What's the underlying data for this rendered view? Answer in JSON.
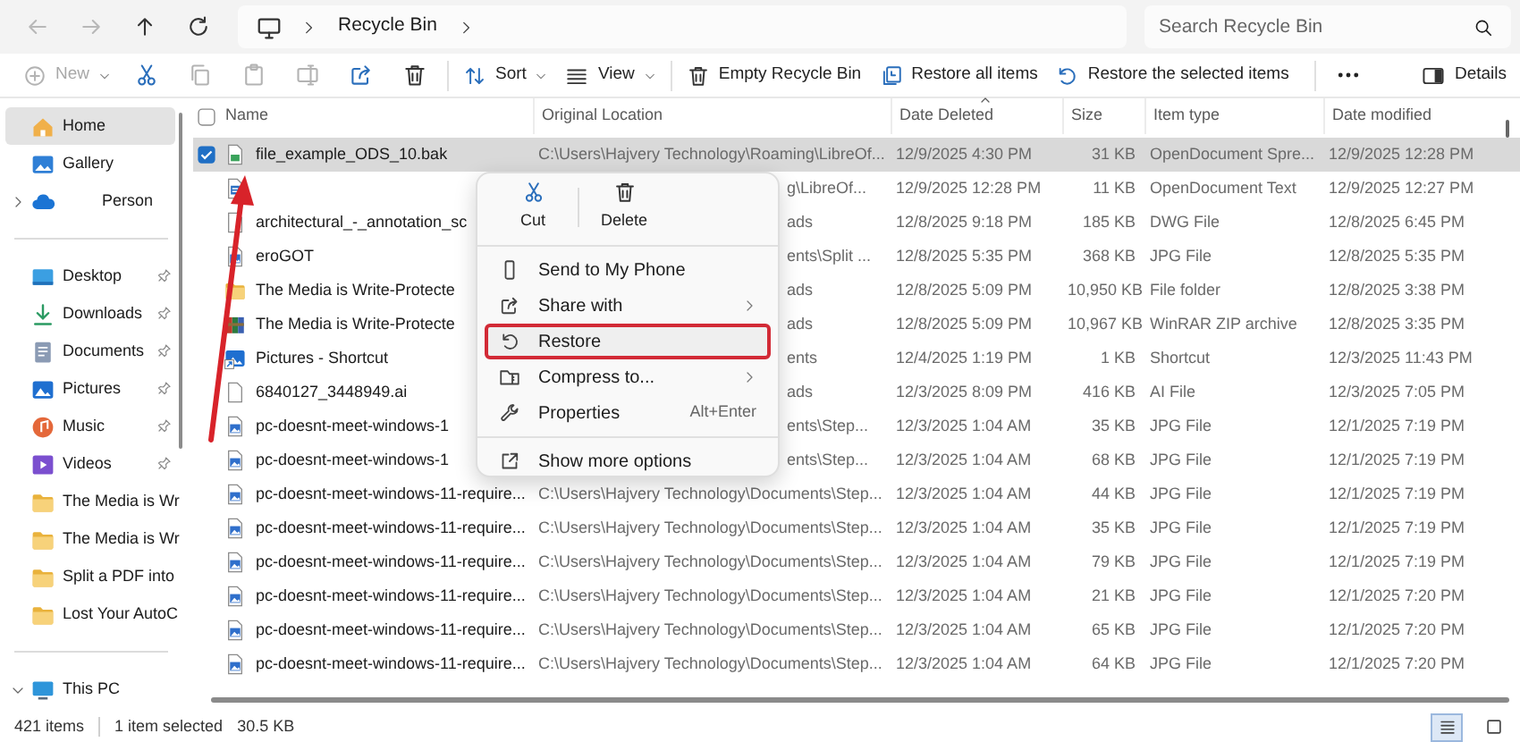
{
  "nav": [
    {
      "disabled": true
    },
    {
      "disabled": true
    },
    {
      "disabled": false
    },
    {
      "disabled": false
    }
  ],
  "address": {
    "crumbs": [
      "Recycle Bin"
    ]
  },
  "search": {
    "placeholder": "Search Recycle Bin"
  },
  "toolbar": {
    "groups": [
      [
        {
          "label": "New",
          "disabled": true,
          "dropdown": true
        },
        {
          "disabled": false,
          "dropdown": false
        },
        {
          "disabled": true,
          "dropdown": false
        },
        {
          "disabled": true,
          "dropdown": false
        },
        {
          "disabled": true,
          "dropdown": false
        },
        {
          "disabled": false,
          "dropdown": false
        },
        {
          "disabled": false,
          "dropdown": false
        }
      ],
      [
        {
          "label": "Sort",
          "disabled": false,
          "dropdown": true
        },
        {
          "label": "View",
          "disabled": false,
          "dropdown": true
        }
      ],
      [
        {
          "label": "Empty Recycle Bin",
          "disabled": false,
          "dropdown": false
        },
        {
          "label": "Restore all items",
          "disabled": false,
          "dropdown": false
        },
        {
          "label": "Restore the selected items",
          "disabled": false,
          "dropdown": false
        }
      ],
      [
        {
          "disabled": false,
          "dropdown": false
        }
      ]
    ],
    "details": {
      "label": "Details"
    }
  },
  "sidebar": {
    "items": [
      {
        "label": "Home",
        "selected": true
      },
      {
        "label": "Gallery",
        "selected": false
      },
      {
        "label": "Person",
        "selected": false,
        "expanded": false
      }
    ],
    "quick_access": [
      {
        "label": "Desktop",
        "pinned": true
      },
      {
        "label": "Downloads",
        "pinned": true
      },
      {
        "label": "Documents",
        "pinned": true
      },
      {
        "label": "Pictures",
        "pinned": true
      },
      {
        "label": "Music",
        "pinned": true
      },
      {
        "label": "Videos",
        "pinned": true
      },
      {
        "label": "The Media is Wr",
        "pinned": false
      },
      {
        "label": "The Media is Wr",
        "pinned": false
      },
      {
        "label": "Split a PDF into",
        "pinned": false
      },
      {
        "label": "Lost Your AutoC",
        "pinned": false
      }
    ],
    "this_pc": {
      "label": "This PC",
      "expanded": true
    }
  },
  "table": {
    "select_all": {
      "checked": false
    },
    "columns": [
      {
        "label": "Name",
        "sorted": false
      },
      {
        "label": "Original Location",
        "sorted": false
      },
      {
        "label": "Date Deleted",
        "sorted": true
      },
      {
        "label": "Size",
        "sorted": false
      },
      {
        "label": "Item type",
        "sorted": false
      },
      {
        "label": "Date modified",
        "sorted": false
      }
    ],
    "rows": [
      {
        "kind": "spreadsheet",
        "selected": true,
        "name": "file_example_ODS_10.bak",
        "location": "C:\\Users\\Hajvery Technology\\Roaming\\LibreOf...",
        "deleted": "12/9/2025 4:30 PM",
        "size": "31 KB",
        "type": "OpenDocument Spre...",
        "modified": "12/9/2025 12:28 PM"
      },
      {
        "kind": "document",
        "selected": false,
        "location": "g\\LibreOf...",
        "deleted": "12/9/2025 12:28 PM",
        "size": "11 KB",
        "type": "OpenDocument Text",
        "modified": "12/9/2025 12:27 PM"
      },
      {
        "kind": "file",
        "selected": false,
        "name": "architectural_-_annotation_sc",
        "location": "ads",
        "deleted": "12/8/2025 9:18 PM",
        "size": "185 KB",
        "type": "DWG File",
        "modified": "12/8/2025 6:45 PM"
      },
      {
        "kind": "image",
        "selected": false,
        "name": "eroGOT",
        "location": "ents\\Split ...",
        "deleted": "12/8/2025 5:35 PM",
        "size": "368 KB",
        "type": "JPG File",
        "modified": "12/8/2025 5:35 PM"
      },
      {
        "kind": "folder",
        "selected": false,
        "name": "The Media is Write-Protecte",
        "location": "ads",
        "deleted": "12/8/2025 5:09 PM",
        "size": "10,950 KB",
        "type": "File folder",
        "modified": "12/8/2025 3:38 PM"
      },
      {
        "kind": "archive",
        "selected": false,
        "name": "The Media is Write-Protecte",
        "location": "ads",
        "deleted": "12/8/2025 5:09 PM",
        "size": "10,967 KB",
        "type": "WinRAR ZIP archive",
        "modified": "12/8/2025 3:35 PM"
      },
      {
        "kind": "shortcut",
        "selected": false,
        "name": "Pictures - Shortcut",
        "location": "ents",
        "deleted": "12/4/2025 1:19 PM",
        "size": "1 KB",
        "type": "Shortcut",
        "modified": "12/3/2025 11:43 PM"
      },
      {
        "kind": "file",
        "selected": false,
        "name": "6840127_3448949.ai",
        "location": "ads",
        "deleted": "12/3/2025 8:09 PM",
        "size": "416 KB",
        "type": "AI File",
        "modified": "12/3/2025 7:05 PM"
      },
      {
        "kind": "image",
        "selected": false,
        "name": "pc-doesnt-meet-windows-1",
        "location": "ents\\Step...",
        "deleted": "12/3/2025 1:04 AM",
        "size": "35 KB",
        "type": "JPG File",
        "modified": "12/1/2025 7:19 PM"
      },
      {
        "kind": "image",
        "selected": false,
        "name": "pc-doesnt-meet-windows-1",
        "location": "ents\\Step...",
        "deleted": "12/3/2025 1:04 AM",
        "size": "68 KB",
        "type": "JPG File",
        "modified": "12/1/2025 7:19 PM"
      },
      {
        "kind": "image",
        "selected": false,
        "name": "pc-doesnt-meet-windows-11-require...",
        "location": "C:\\Users\\Hajvery Technology\\Documents\\Step...",
        "deleted": "12/3/2025 1:04 AM",
        "size": "44 KB",
        "type": "JPG File",
        "modified": "12/1/2025 7:19 PM"
      },
      {
        "kind": "image",
        "selected": false,
        "name": "pc-doesnt-meet-windows-11-require...",
        "location": "C:\\Users\\Hajvery Technology\\Documents\\Step...",
        "deleted": "12/3/2025 1:04 AM",
        "size": "35 KB",
        "type": "JPG File",
        "modified": "12/1/2025 7:19 PM"
      },
      {
        "kind": "image",
        "selected": false,
        "name": "pc-doesnt-meet-windows-11-require...",
        "location": "C:\\Users\\Hajvery Technology\\Documents\\Step...",
        "deleted": "12/3/2025 1:04 AM",
        "size": "79 KB",
        "type": "JPG File",
        "modified": "12/1/2025 7:19 PM"
      },
      {
        "kind": "image",
        "selected": false,
        "name": "pc-doesnt-meet-windows-11-require...",
        "location": "C:\\Users\\Hajvery Technology\\Documents\\Step...",
        "deleted": "12/3/2025 1:04 AM",
        "size": "21 KB",
        "type": "JPG File",
        "modified": "12/1/2025 7:20 PM"
      },
      {
        "kind": "image",
        "selected": false,
        "name": "pc-doesnt-meet-windows-11-require...",
        "location": "C:\\Users\\Hajvery Technology\\Documents\\Step...",
        "deleted": "12/3/2025 1:04 AM",
        "size": "65 KB",
        "type": "JPG File",
        "modified": "12/1/2025 7:20 PM"
      },
      {
        "kind": "image",
        "selected": false,
        "name": "pc-doesnt-meet-windows-11-require...",
        "location": "C:\\Users\\Hajvery Technology\\Documents\\Step...",
        "deleted": "12/3/2025 1:04 AM",
        "size": "64 KB",
        "type": "JPG File",
        "modified": "12/1/2025 7:20 PM"
      }
    ]
  },
  "context_menu": {
    "quick_actions": [
      {
        "label": "Cut"
      },
      {
        "label": "Delete"
      }
    ],
    "items": [
      {
        "label": "Send to My Phone",
        "submenu": false,
        "highlighted": false
      },
      {
        "label": "Share with",
        "submenu": true,
        "highlighted": false
      },
      {
        "label": "Restore",
        "submenu": false,
        "highlighted": true
      },
      {
        "label": "Compress to...",
        "submenu": true,
        "highlighted": false
      },
      {
        "label": "Properties",
        "submenu": false,
        "highlighted": false,
        "shortcut": "Alt+Enter"
      }
    ],
    "more": {
      "label": "Show more options"
    }
  },
  "status": {
    "count": "421 items",
    "selection": "1 item selected",
    "size": "30.5 KB",
    "views": [
      {
        "selected": true
      },
      {
        "selected": false
      }
    ]
  }
}
